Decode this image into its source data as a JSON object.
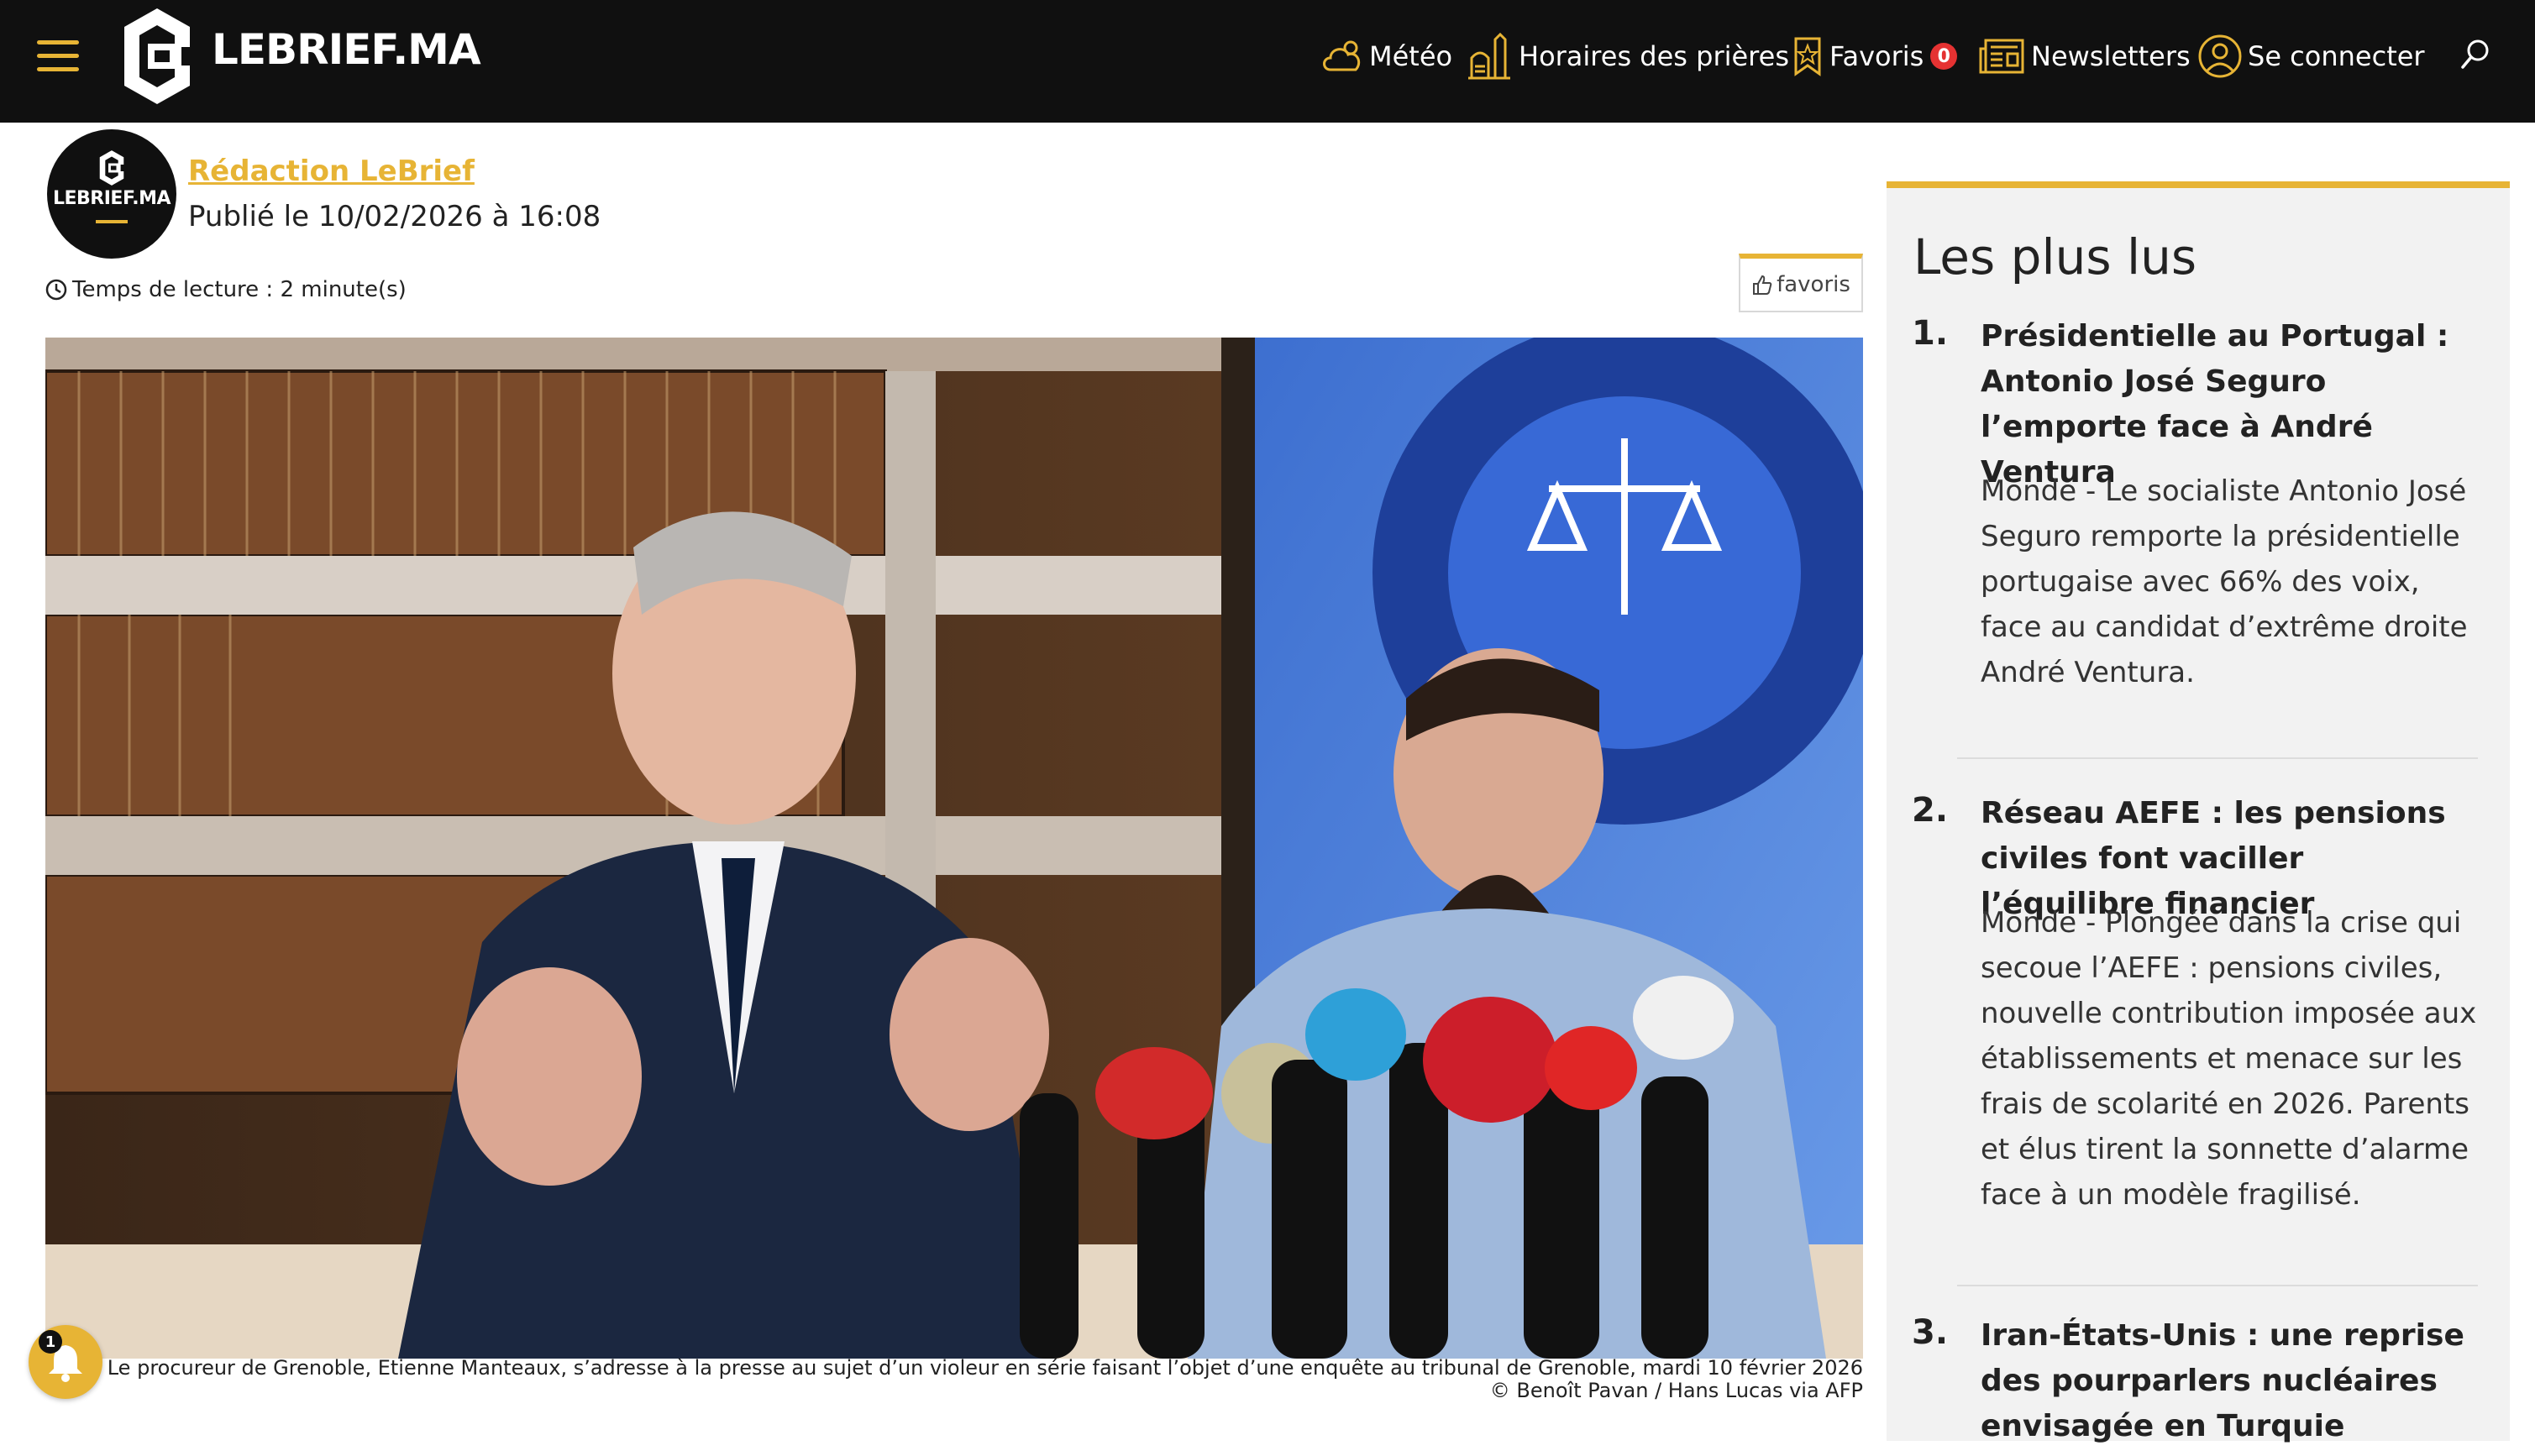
{
  "header": {
    "logo_text": "LEBRIEF.MA",
    "nav": {
      "meteo": "Météo",
      "prayer": "Horaires des prières",
      "favorites": "Favoris",
      "favorites_count": "0",
      "newsletters": "Newsletters",
      "login": "Se connecter"
    },
    "icons": [
      "menu-icon",
      "weather-cloud-icon",
      "mosque-icon",
      "bookmark-star-icon",
      "newspaper-icon",
      "user-icon",
      "search-icon"
    ]
  },
  "article": {
    "author_avatar_text": "LEBRIEF.MA",
    "author": "Rédaction LeBrief",
    "published": "Publié le 10/02/2026 à 16:08",
    "reading_time": "Temps de lecture : 2 minute(s)",
    "favorite_button": "favoris",
    "image_caption": "Le procureur de Grenoble, Etienne Manteaux, s’adresse à la presse au sujet d’un violeur en série faisant l’objet d’une enquête au tribunal de Grenoble, mardi 10 février 2026 © Benoît Pavan / Hans Lucas via AFP",
    "notification_count": "1"
  },
  "sidebar": {
    "title": "Les plus lus",
    "items": [
      {
        "num": "1.",
        "title": "Présidentielle au Portugal : Antonio José Seguro l’emporte face à André Ventura",
        "desc": "Monde - Le socialiste Antonio José Seguro remporte la présidentielle portugaise avec 66% des voix, face au candidat d’extrême droite André Ventura."
      },
      {
        "num": "2.",
        "title": "Réseau AEFE : les pensions civiles font vaciller l’équilibre financier",
        "desc": "Monde - Plongée dans la crise qui secoue l’AEFE : pensions civiles, nouvelle contribution imposée aux établissements et menace sur les frais de scolarité en 2026. Parents et élus tirent la sonnette d’alarme face à un modèle fragilisé."
      },
      {
        "num": "3.",
        "title": "Iran-États-Unis : une reprise des pourparlers nucléaires envisagée en Turquie",
        "desc": ""
      }
    ]
  },
  "colors": {
    "accent": "#e7b435",
    "header_bg": "#101010",
    "badge": "#e53232",
    "sidebar_bg": "#f2f2f2"
  }
}
